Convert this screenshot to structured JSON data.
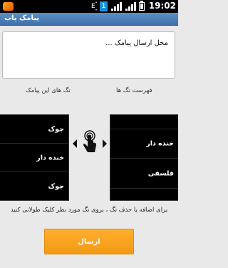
{
  "status_bar": {
    "time": "19:02",
    "notification_count": "1"
  },
  "app": {
    "title": "پیامک یاب"
  },
  "message": {
    "placeholder": "محل ارسال پیامک ..."
  },
  "labels": {
    "message_tags": "تگ های این پیامک",
    "tag_list": "فهرست تگ ها"
  },
  "message_tags": [
    {
      "label": "جوک"
    },
    {
      "label": "خنده دار"
    },
    {
      "label": "جوک"
    }
  ],
  "tag_list": [
    {
      "label": ""
    },
    {
      "label": "خنده دار"
    },
    {
      "label": "فلسفی"
    },
    {
      "label": ""
    }
  ],
  "hint": "برای اضافه یا حذف تگ ، بروی تگ مورد نظر کلیک طولانی کنید",
  "send_button": {
    "label": "ارسال"
  },
  "colors": {
    "title_bar": "#4a7cb5",
    "send_button": "#f9a321",
    "list_bg": "#000000"
  }
}
